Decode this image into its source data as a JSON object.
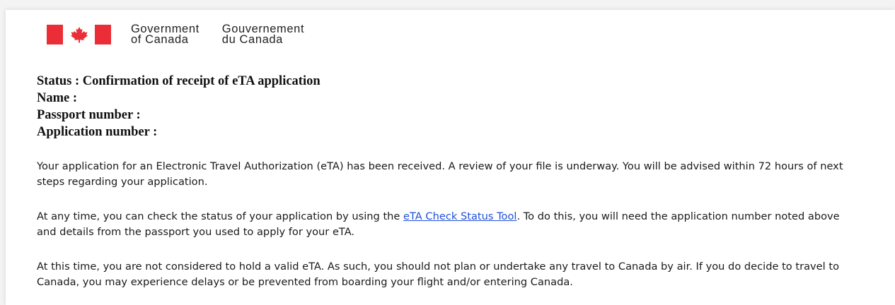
{
  "header": {
    "logo_icon": "canada-flag-icon",
    "logo_colors": {
      "red": "#eb2d37",
      "white": "#ffffff"
    },
    "english_line1": "Government",
    "english_line2": "of Canada",
    "french_line1": "Gouvernement",
    "french_line2": "du Canada"
  },
  "status": {
    "status_line": "Status : Confirmation of receipt of eTA application",
    "name_label": "Name :",
    "passport_label": "Passport number :",
    "application_label": "Application number :"
  },
  "body": {
    "paragraph1": "Your application for an Electronic Travel Authorization (eTA) has been received. A review of your file is underway. You will be advised within 72 hours of next steps regarding your application.",
    "paragraph2_before": "At any time, you can check the status of your application by using the ",
    "paragraph2_link": "eTA Check Status Tool",
    "paragraph2_after": ". To do this, you will need the application number noted above and details from the passport you used to apply for your eTA.",
    "paragraph3": "At this time, you are not considered to hold a valid eTA. As such, you should not plan or undertake any travel to Canada by air. If you do decide to travel to Canada, you may experience delays or be prevented from boarding your flight and/or entering Canada."
  },
  "colors": {
    "link": "#1f4fd8",
    "text": "#1a1a1a"
  }
}
